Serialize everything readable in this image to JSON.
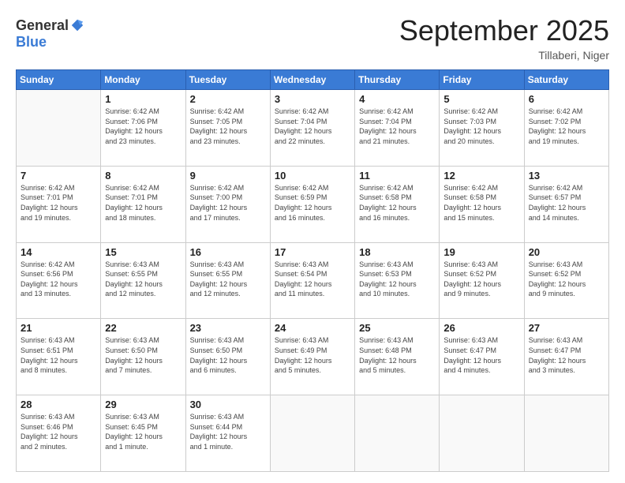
{
  "header": {
    "logo_general": "General",
    "logo_blue": "Blue",
    "month_title": "September 2025",
    "subtitle": "Tillaberi, Niger"
  },
  "calendar": {
    "days_of_week": [
      "Sunday",
      "Monday",
      "Tuesday",
      "Wednesday",
      "Thursday",
      "Friday",
      "Saturday"
    ],
    "weeks": [
      [
        {
          "day": "",
          "info": ""
        },
        {
          "day": "1",
          "info": "Sunrise: 6:42 AM\nSunset: 7:06 PM\nDaylight: 12 hours\nand 23 minutes."
        },
        {
          "day": "2",
          "info": "Sunrise: 6:42 AM\nSunset: 7:05 PM\nDaylight: 12 hours\nand 23 minutes."
        },
        {
          "day": "3",
          "info": "Sunrise: 6:42 AM\nSunset: 7:04 PM\nDaylight: 12 hours\nand 22 minutes."
        },
        {
          "day": "4",
          "info": "Sunrise: 6:42 AM\nSunset: 7:04 PM\nDaylight: 12 hours\nand 21 minutes."
        },
        {
          "day": "5",
          "info": "Sunrise: 6:42 AM\nSunset: 7:03 PM\nDaylight: 12 hours\nand 20 minutes."
        },
        {
          "day": "6",
          "info": "Sunrise: 6:42 AM\nSunset: 7:02 PM\nDaylight: 12 hours\nand 19 minutes."
        }
      ],
      [
        {
          "day": "7",
          "info": "Sunrise: 6:42 AM\nSunset: 7:01 PM\nDaylight: 12 hours\nand 19 minutes."
        },
        {
          "day": "8",
          "info": "Sunrise: 6:42 AM\nSunset: 7:01 PM\nDaylight: 12 hours\nand 18 minutes."
        },
        {
          "day": "9",
          "info": "Sunrise: 6:42 AM\nSunset: 7:00 PM\nDaylight: 12 hours\nand 17 minutes."
        },
        {
          "day": "10",
          "info": "Sunrise: 6:42 AM\nSunset: 6:59 PM\nDaylight: 12 hours\nand 16 minutes."
        },
        {
          "day": "11",
          "info": "Sunrise: 6:42 AM\nSunset: 6:58 PM\nDaylight: 12 hours\nand 16 minutes."
        },
        {
          "day": "12",
          "info": "Sunrise: 6:42 AM\nSunset: 6:58 PM\nDaylight: 12 hours\nand 15 minutes."
        },
        {
          "day": "13",
          "info": "Sunrise: 6:42 AM\nSunset: 6:57 PM\nDaylight: 12 hours\nand 14 minutes."
        }
      ],
      [
        {
          "day": "14",
          "info": "Sunrise: 6:42 AM\nSunset: 6:56 PM\nDaylight: 12 hours\nand 13 minutes."
        },
        {
          "day": "15",
          "info": "Sunrise: 6:43 AM\nSunset: 6:55 PM\nDaylight: 12 hours\nand 12 minutes."
        },
        {
          "day": "16",
          "info": "Sunrise: 6:43 AM\nSunset: 6:55 PM\nDaylight: 12 hours\nand 12 minutes."
        },
        {
          "day": "17",
          "info": "Sunrise: 6:43 AM\nSunset: 6:54 PM\nDaylight: 12 hours\nand 11 minutes."
        },
        {
          "day": "18",
          "info": "Sunrise: 6:43 AM\nSunset: 6:53 PM\nDaylight: 12 hours\nand 10 minutes."
        },
        {
          "day": "19",
          "info": "Sunrise: 6:43 AM\nSunset: 6:52 PM\nDaylight: 12 hours\nand 9 minutes."
        },
        {
          "day": "20",
          "info": "Sunrise: 6:43 AM\nSunset: 6:52 PM\nDaylight: 12 hours\nand 9 minutes."
        }
      ],
      [
        {
          "day": "21",
          "info": "Sunrise: 6:43 AM\nSunset: 6:51 PM\nDaylight: 12 hours\nand 8 minutes."
        },
        {
          "day": "22",
          "info": "Sunrise: 6:43 AM\nSunset: 6:50 PM\nDaylight: 12 hours\nand 7 minutes."
        },
        {
          "day": "23",
          "info": "Sunrise: 6:43 AM\nSunset: 6:50 PM\nDaylight: 12 hours\nand 6 minutes."
        },
        {
          "day": "24",
          "info": "Sunrise: 6:43 AM\nSunset: 6:49 PM\nDaylight: 12 hours\nand 5 minutes."
        },
        {
          "day": "25",
          "info": "Sunrise: 6:43 AM\nSunset: 6:48 PM\nDaylight: 12 hours\nand 5 minutes."
        },
        {
          "day": "26",
          "info": "Sunrise: 6:43 AM\nSunset: 6:47 PM\nDaylight: 12 hours\nand 4 minutes."
        },
        {
          "day": "27",
          "info": "Sunrise: 6:43 AM\nSunset: 6:47 PM\nDaylight: 12 hours\nand 3 minutes."
        }
      ],
      [
        {
          "day": "28",
          "info": "Sunrise: 6:43 AM\nSunset: 6:46 PM\nDaylight: 12 hours\nand 2 minutes."
        },
        {
          "day": "29",
          "info": "Sunrise: 6:43 AM\nSunset: 6:45 PM\nDaylight: 12 hours\nand 1 minute."
        },
        {
          "day": "30",
          "info": "Sunrise: 6:43 AM\nSunset: 6:44 PM\nDaylight: 12 hours\nand 1 minute."
        },
        {
          "day": "",
          "info": ""
        },
        {
          "day": "",
          "info": ""
        },
        {
          "day": "",
          "info": ""
        },
        {
          "day": "",
          "info": ""
        }
      ]
    ]
  }
}
